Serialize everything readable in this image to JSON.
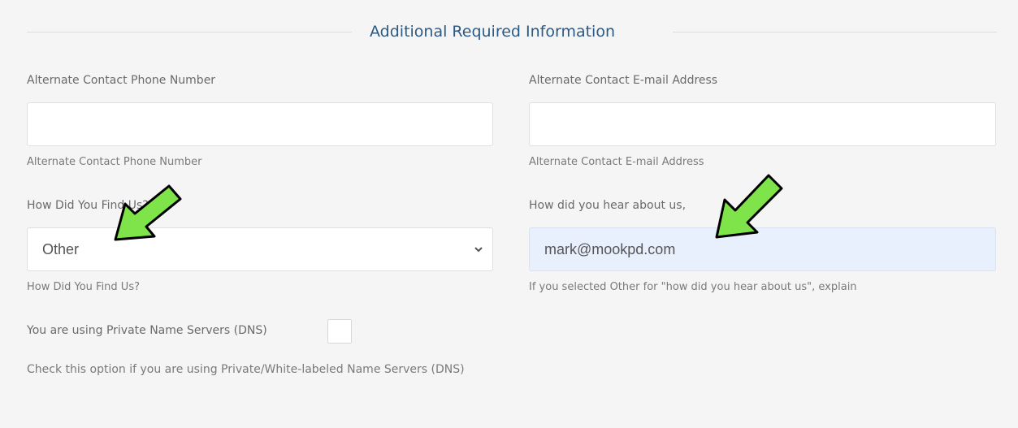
{
  "section": {
    "title": "Additional Required Information"
  },
  "alt_phone": {
    "label": "Alternate Contact Phone Number",
    "value": "",
    "help": "Alternate Contact Phone Number"
  },
  "alt_email": {
    "label": "Alternate Contact E-mail Address",
    "value": "",
    "help": "Alternate Contact E-mail Address"
  },
  "find_us": {
    "label": "How Did You Find Us?",
    "selected": "Other",
    "help": "How Did You Find Us?"
  },
  "hear_about": {
    "label": "How did you hear about us,",
    "value": "mark@mookpd.com",
    "help": "If you selected Other for \"how did you hear about us\", explain"
  },
  "private_dns": {
    "label": "You are using Private Name Servers (DNS)",
    "checked": false,
    "help": "Check this option if you are using Private/White-labeled Name Servers (DNS)"
  },
  "annotations": {
    "arrow_color": "#7ee44a",
    "arrow_outline": "#000000"
  }
}
